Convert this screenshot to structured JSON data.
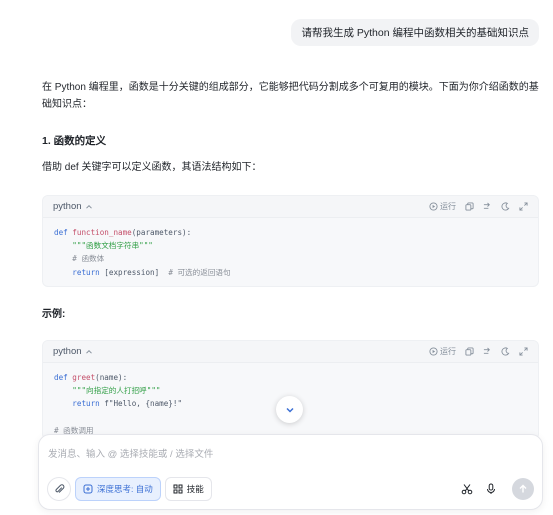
{
  "user_message": "请帮我生成 Python 编程中函数相关的基础知识点",
  "answer": {
    "intro": "在 Python 编程里，函数是十分关键的组成部分，它能够把代码分割成多个可复用的模块。下面为你介绍函数的基础知识点：",
    "section1_title": "1. 函数的定义",
    "section1_text": "借助 def 关键字可以定义函数，其语法结构如下：",
    "example_title": "示例:"
  },
  "codeblock": {
    "lang": "python",
    "run_label": "运行"
  },
  "code1": {
    "l1_kw": "def",
    "l1_fn": "function_name",
    "l1_rest": "(parameters):",
    "l2": "\"\"\"函数文档字符串\"\"\"",
    "l3": "# 函数体",
    "l4_kw": "return",
    "l4_rest": " [expression]  ",
    "l4_cm": "# 可选的返回语句"
  },
  "code2": {
    "l1_kw": "def",
    "l1_fn": "greet",
    "l1_rest": "(name):",
    "l2": "\"\"\"向指定的人打招呼\"\"\"",
    "l3_kw": "return",
    "l3_rest": " f\"Hello, {name}!\"",
    "l5": "# 函数调用"
  },
  "composer": {
    "placeholder": "发消息、输入 @ 选择技能或 / 选择文件",
    "deep_think_label": "深度思考: 自动",
    "skills_label": "技能"
  },
  "icons": {
    "lang_toggle": "chevron-up-icon",
    "run": "play-circle-icon",
    "copy": "copy-icon",
    "wrap": "wrap-icon",
    "theme": "moon-icon",
    "expand": "expand-icon",
    "scroll": "chevron-down-icon",
    "attach": "paperclip-icon",
    "deep_think": "brain-icon",
    "skills": "grid-icon",
    "scissors": "scissors-icon",
    "mic": "microphone-icon",
    "send": "arrow-up-icon"
  }
}
